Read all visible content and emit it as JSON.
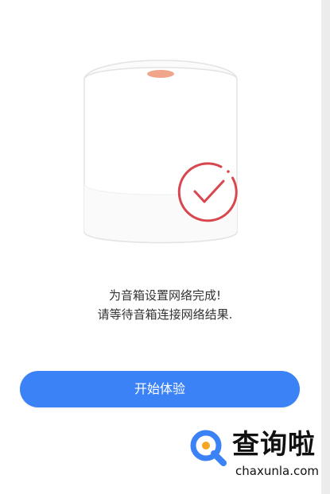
{
  "message": {
    "line1": "为音箱设置网络完成!",
    "line2": "请等待音箱连接网络结果."
  },
  "button": {
    "start_label": "开始体验"
  },
  "watermark": {
    "title": "查询啦",
    "url": "chaxunla.com"
  },
  "colors": {
    "button": "#3b82f6",
    "check": "#d8474f",
    "watermark_q": "#3b82f6",
    "watermark_dot": "#f5a623"
  },
  "icons": {
    "speaker": "smart-speaker-illustration",
    "check": "check-circle-icon",
    "logo": "q-magnifier-logo"
  }
}
